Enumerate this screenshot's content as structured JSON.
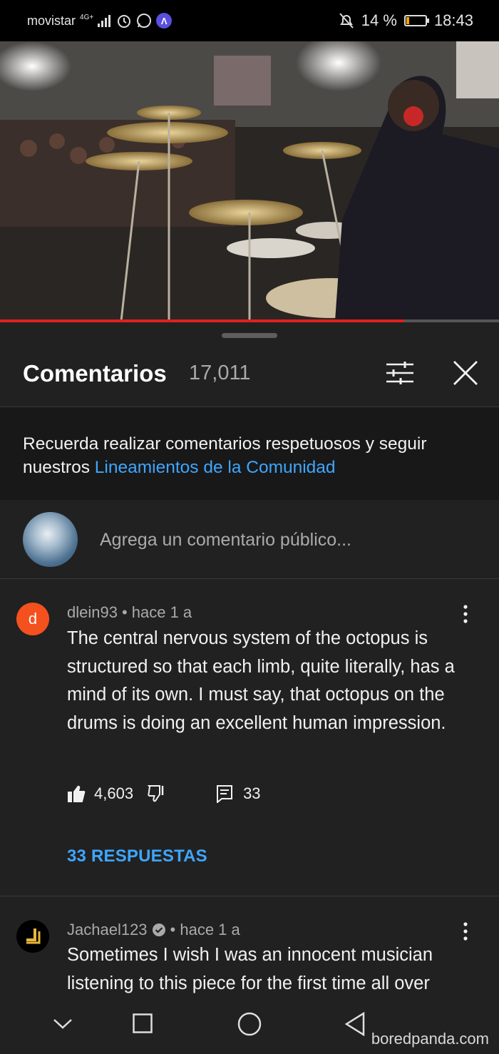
{
  "status_bar": {
    "carrier": "movistar",
    "network": "4G+",
    "battery_text": "14 %",
    "battery_level": 0.14,
    "time": "18:43",
    "vpn_glyph": "Λ"
  },
  "video": {
    "progress": 0.81,
    "accent_color": "#e0201f"
  },
  "comments_panel": {
    "title": "Comentarios",
    "count": "17,011",
    "notice_text": "Recuerda realizar comentarios respetuosos y seguir nuestros ",
    "notice_link": "Lineamientos de la Comunidad",
    "add_placeholder": "Agrega un comentario público..."
  },
  "comments": [
    {
      "avatar_letter": "d",
      "author": "dlein93",
      "time": "• hace 1 a",
      "text": "The central nervous system of the octopus is structured so that each limb, quite literally, has a mind of its own. I must say, that octopus on the drums is doing an excellent human impression.",
      "likes": "4,603",
      "reply_count": "33",
      "replies_label": "33 RESPUESTAS"
    },
    {
      "author": "Jachael123",
      "time": "• hace 1 a",
      "text": "Sometimes I wish I was an innocent musician listening to this piece for the first time all over"
    }
  ],
  "watermark": "boredpanda.com",
  "icons": {
    "filter": "sliders-icon",
    "close": "close-icon",
    "like": "thumbs-up-icon",
    "dislike": "thumbs-down-icon",
    "reply": "comment-icon",
    "more": "more-vert-icon",
    "verified": "verified-check-icon"
  },
  "colors": {
    "link": "#3ea6ff",
    "background": "#212121",
    "notice_bg": "#181818"
  }
}
